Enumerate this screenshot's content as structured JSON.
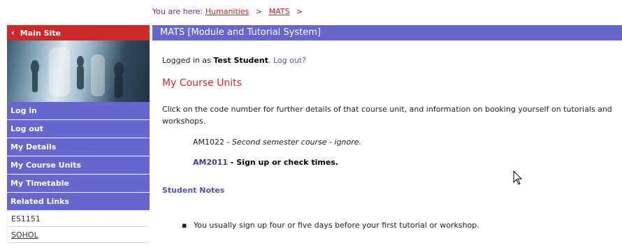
{
  "breadcrumb": {
    "prefix": "You are here:",
    "items": [
      "Humanities",
      "MATS"
    ],
    "separator": ">"
  },
  "sidebar": {
    "main_site": "Main Site",
    "nav": [
      "Log in",
      "Log out",
      "My Details",
      "My Course Units",
      "My Timetable",
      "Related Links"
    ],
    "links": [
      "ES1151",
      "SOHOL"
    ]
  },
  "header": {
    "title": "MATS [Module and Tutorial System]"
  },
  "login": {
    "prefix": "Logged in as",
    "user": "Test Student",
    "suffix": ".",
    "logout": "Log out?"
  },
  "section_title": "My Course Units",
  "intro": "Click on the code number for further details of that course unit, and information on booking yourself on tutorials and workshops.",
  "courses": [
    {
      "code": "AM1022",
      "sep": " - ",
      "note": "Second semester course - ignore."
    },
    {
      "code": "AM2011",
      "sep": " - ",
      "note": "Sign up or check times."
    }
  ],
  "notes": {
    "title": "Student Notes",
    "items": [
      "You usually sign up four or five days before your first tutorial or workshop."
    ]
  },
  "colors": {
    "nav": "#6666cc",
    "accent_red": "#cc2a2a"
  }
}
